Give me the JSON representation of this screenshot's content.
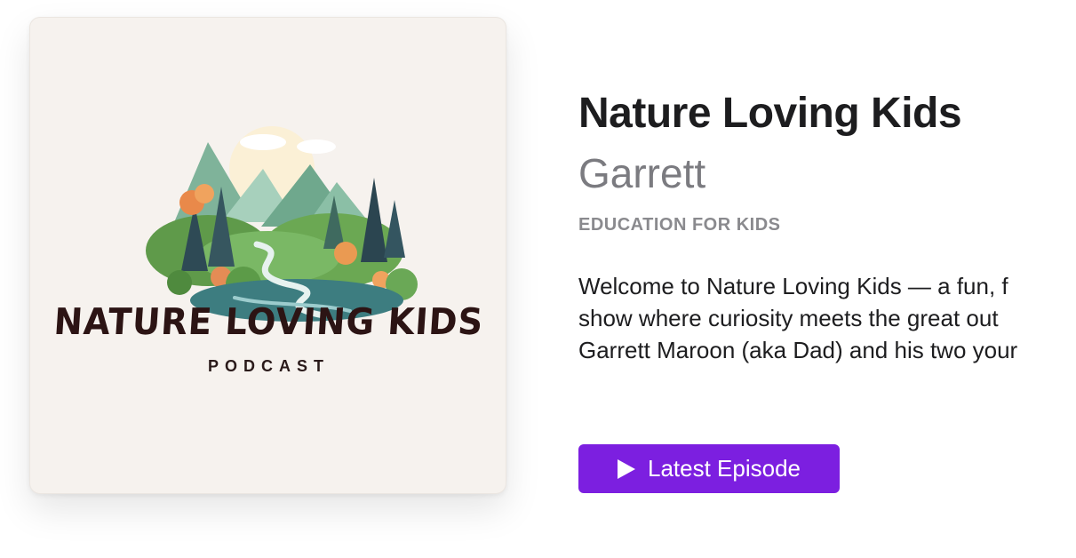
{
  "artwork": {
    "title": "NATURE LOVING KIDS",
    "subtitle": "PODCAST"
  },
  "podcast": {
    "title": "Nature Loving Kids",
    "author": "Garrett",
    "category": "EDUCATION FOR KIDS",
    "description_lines": [
      "Welcome to Nature Loving Kids — a fun, f",
      "show where curiosity meets the great out",
      "Garrett Maroon (aka Dad) and his two your"
    ]
  },
  "actions": {
    "latest_episode_label": "Latest Episode",
    "latest_episode_icon": "play-icon"
  },
  "colors": {
    "accent": "#7c1fe0",
    "artwork_background": "#f6f2ee",
    "title_text": "#1d1d1f",
    "secondary_text": "#7b7b80"
  }
}
